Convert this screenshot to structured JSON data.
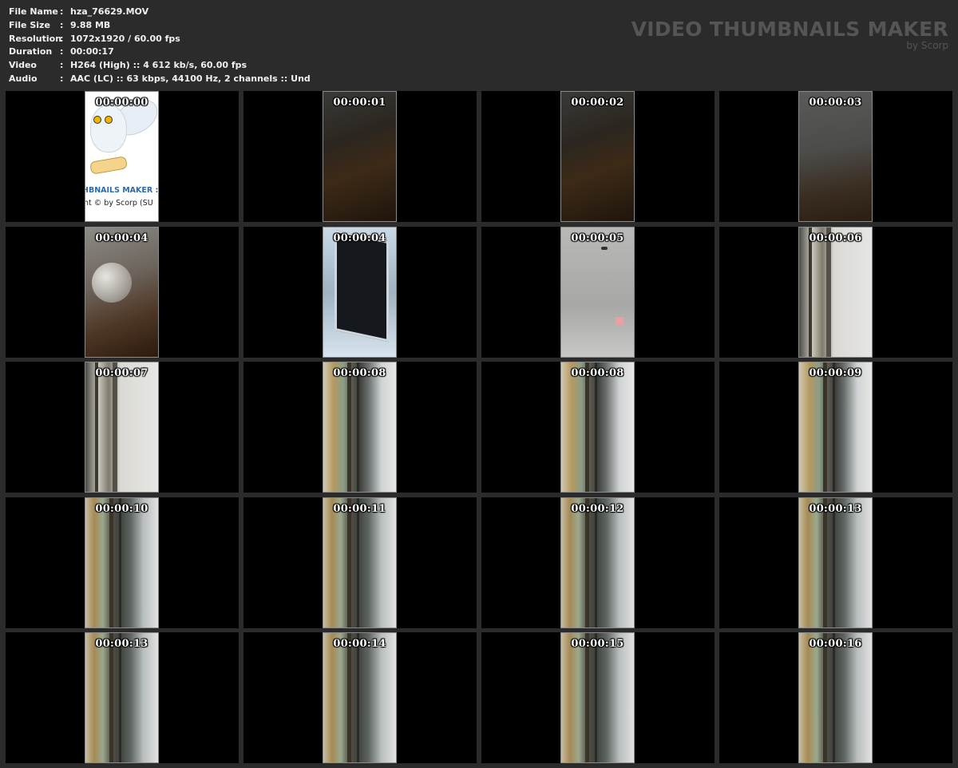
{
  "info": {
    "rows": [
      {
        "label": "File Name",
        "value": "hza_76629.MOV"
      },
      {
        "label": "File Size",
        "value": "9.88 MB"
      },
      {
        "label": "Resolution",
        "value": "1072x1920 / 60.00 fps"
      },
      {
        "label": "Duration",
        "value": "00:00:17"
      },
      {
        "label": "Video",
        "value": "H264 (High) :: 4 612 kb/s, 60.00 fps"
      },
      {
        "label": "Audio",
        "value": "AAC (LC) :: 63 kbps, 44100 Hz, 2 channels :: Und"
      }
    ],
    "separator": ":"
  },
  "brand": {
    "title": "VIDEO THUMBNAILS MAKER",
    "subtitle": "by Scorp"
  },
  "intro_frame": {
    "product_text": "HBNAILS MAKER :",
    "copyright_text": "nt © by Scorp (SU"
  },
  "thumbnails": [
    {
      "timestamp": "00:00:00",
      "scene": "intro"
    },
    {
      "timestamp": "00:00:01",
      "scene": "dark"
    },
    {
      "timestamp": "00:00:02",
      "scene": "dark"
    },
    {
      "timestamp": "00:00:03",
      "scene": "dark2"
    },
    {
      "timestamp": "00:00:04",
      "scene": "clock"
    },
    {
      "timestamp": "00:00:04",
      "scene": "fan"
    },
    {
      "timestamp": "00:00:05",
      "scene": "ceiling"
    },
    {
      "timestamp": "00:00:06",
      "scene": "wall"
    },
    {
      "timestamp": "00:00:07",
      "scene": "wall"
    },
    {
      "timestamp": "00:00:08",
      "scene": "floor"
    },
    {
      "timestamp": "00:00:08",
      "scene": "floor"
    },
    {
      "timestamp": "00:00:09",
      "scene": "floor"
    },
    {
      "timestamp": "00:00:10",
      "scene": "floor2"
    },
    {
      "timestamp": "00:00:11",
      "scene": "floor2"
    },
    {
      "timestamp": "00:00:12",
      "scene": "floor2"
    },
    {
      "timestamp": "00:00:13",
      "scene": "floor2"
    },
    {
      "timestamp": "00:00:13",
      "scene": "floor2"
    },
    {
      "timestamp": "00:00:14",
      "scene": "floor2"
    },
    {
      "timestamp": "00:00:15",
      "scene": "floor2"
    },
    {
      "timestamp": "00:00:16",
      "scene": "floor2"
    }
  ],
  "colors": {
    "page_background": "#2b2b2b",
    "cell_background": "#000000",
    "brand_text": "#555555",
    "info_text": "#f0f0f0"
  }
}
